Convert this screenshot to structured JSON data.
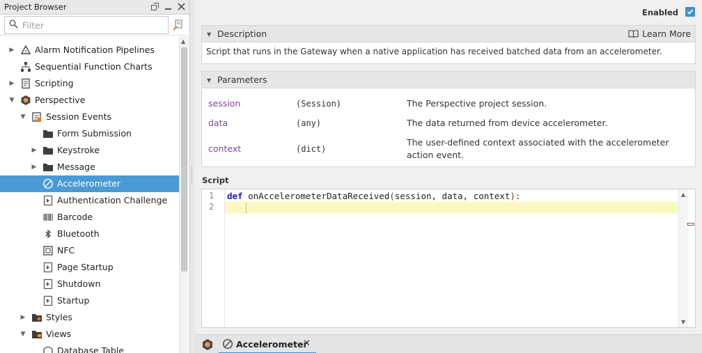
{
  "project_browser": {
    "title": "Project Browser",
    "filter_placeholder": "Filter",
    "tree": [
      {
        "label": "Alarm Notification Pipelines",
        "icon": "pipeline-icon",
        "expand": "collapsed"
      },
      {
        "label": "Sequential Function Charts",
        "icon": "sfc-icon",
        "expand": "none"
      },
      {
        "label": "Scripting",
        "icon": "script-icon",
        "expand": "collapsed"
      },
      {
        "label": "Perspective",
        "icon": "perspective-icon",
        "expand": "expanded"
      },
      {
        "label": "Session Events",
        "icon": "session-events-icon",
        "expand": "expanded"
      },
      {
        "label": "Form Submission",
        "icon": "folder-icon",
        "expand": "none"
      },
      {
        "label": "Keystroke",
        "icon": "folder-icon",
        "expand": "collapsed"
      },
      {
        "label": "Message",
        "icon": "folder-icon",
        "expand": "collapsed"
      },
      {
        "label": "Accelerometer",
        "icon": "accelerometer-icon",
        "expand": "none",
        "selected": true
      },
      {
        "label": "Authentication Challenge",
        "icon": "event-script-icon",
        "expand": "none"
      },
      {
        "label": "Barcode",
        "icon": "barcode-icon",
        "expand": "none"
      },
      {
        "label": "Bluetooth",
        "icon": "bluetooth-icon",
        "expand": "none"
      },
      {
        "label": "NFC",
        "icon": "nfc-icon",
        "expand": "none"
      },
      {
        "label": "Page Startup",
        "icon": "event-script-icon",
        "expand": "none"
      },
      {
        "label": "Shutdown",
        "icon": "event-script-icon",
        "expand": "none"
      },
      {
        "label": "Startup",
        "icon": "event-script-icon",
        "expand": "none"
      },
      {
        "label": "Styles",
        "icon": "styles-icon",
        "expand": "collapsed"
      },
      {
        "label": "Views",
        "icon": "views-icon",
        "expand": "expanded"
      },
      {
        "label": "Database Table",
        "icon": "view-icon",
        "expand": "none"
      }
    ]
  },
  "editor": {
    "enabled_label": "Enabled",
    "enabled": true,
    "description": {
      "header": "Description",
      "learn_more": "Learn More",
      "text": "Script that runs in the Gateway when a native application has received batched data from an accelerometer."
    },
    "parameters": {
      "header": "Parameters",
      "rows": [
        {
          "name": "session",
          "type": "(Session)",
          "desc": "The Perspective project session."
        },
        {
          "name": "data",
          "type": "(any)",
          "desc": "The data returned from device accelerometer."
        },
        {
          "name": "context",
          "type": "(dict)",
          "desc": "The user-defined context associated with the accelerometer action event."
        }
      ]
    },
    "script": {
      "label": "Script",
      "line_numbers": [
        "1",
        "2"
      ],
      "code_keyword": "def",
      "code_func": " onAccelerometerDataReceived",
      "code_open": "(",
      "code_args": "session, data, context",
      "code_close": "):"
    }
  },
  "tabs": {
    "active_label": "Accelerometer",
    "close_glyph": "✕"
  }
}
